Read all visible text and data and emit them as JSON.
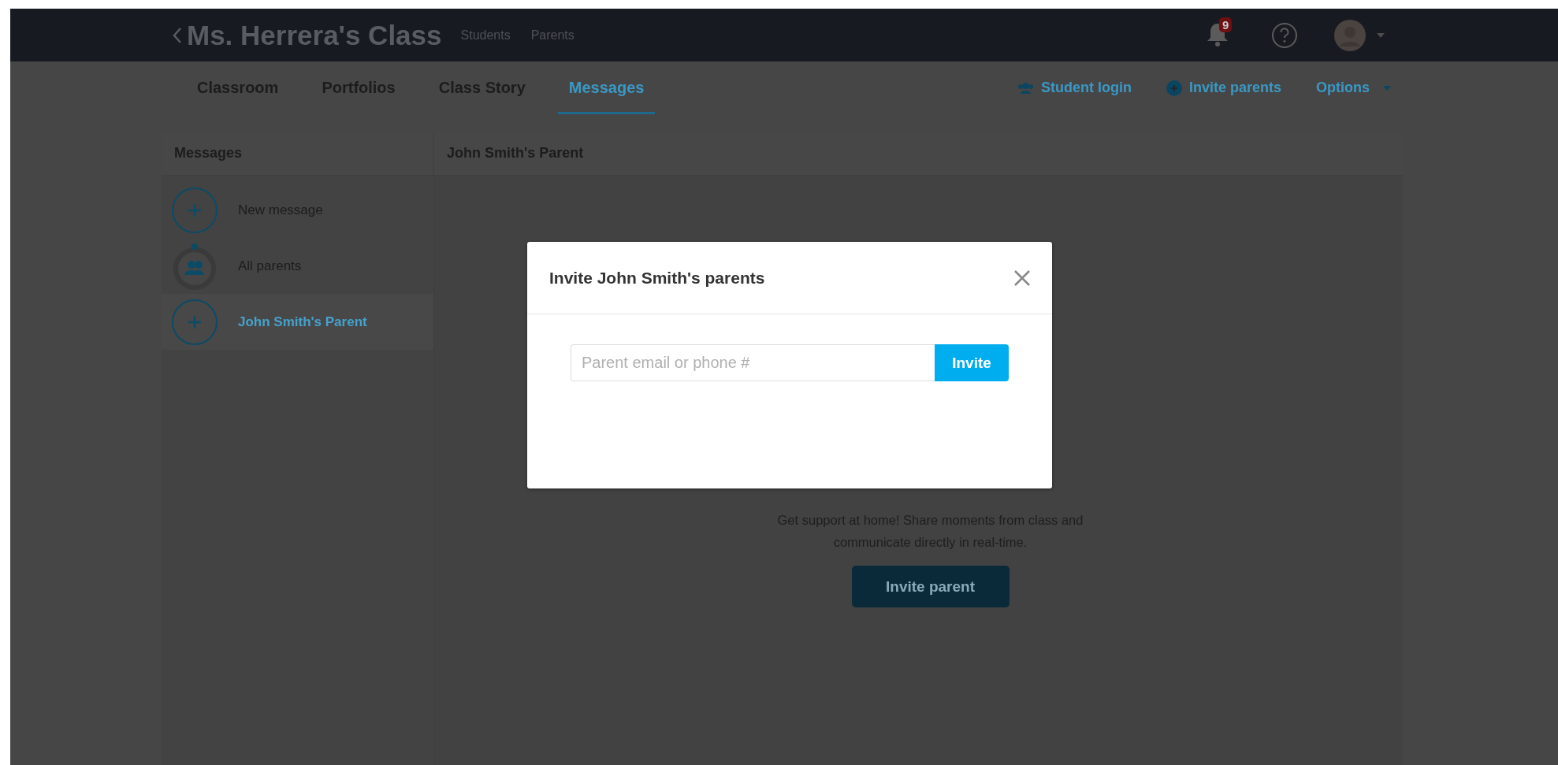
{
  "header": {
    "title": "Ms. Herrera's Class",
    "links": [
      "Students",
      "Parents"
    ],
    "notification_count": "9"
  },
  "tabs": [
    {
      "label": "Classroom",
      "selected": false
    },
    {
      "label": "Portfolios",
      "selected": false
    },
    {
      "label": "Class Story",
      "selected": false
    },
    {
      "label": "Messages",
      "selected": true
    }
  ],
  "actions": [
    {
      "kind": "student-login",
      "label": "Student login"
    },
    {
      "kind": "invite",
      "label": "Invite parents"
    },
    {
      "kind": "options",
      "label": "Options"
    }
  ],
  "messages": {
    "title": "Messages",
    "items": [
      {
        "kind": "new",
        "label": "New message",
        "selected": false
      },
      {
        "kind": "group",
        "label": "All parents",
        "selected": false
      },
      {
        "kind": "new",
        "label": "John Smith's Parent",
        "selected": true
      }
    ]
  },
  "conversation": {
    "title": "John Smith's Parent",
    "description": "Get support at home! Share moments from class and communicate directly in real-time.",
    "button": "Invite parent"
  },
  "dialog": {
    "title": "Invite John Smith's parents",
    "placeholder": "Parent email or phone #",
    "button": "Invite"
  }
}
